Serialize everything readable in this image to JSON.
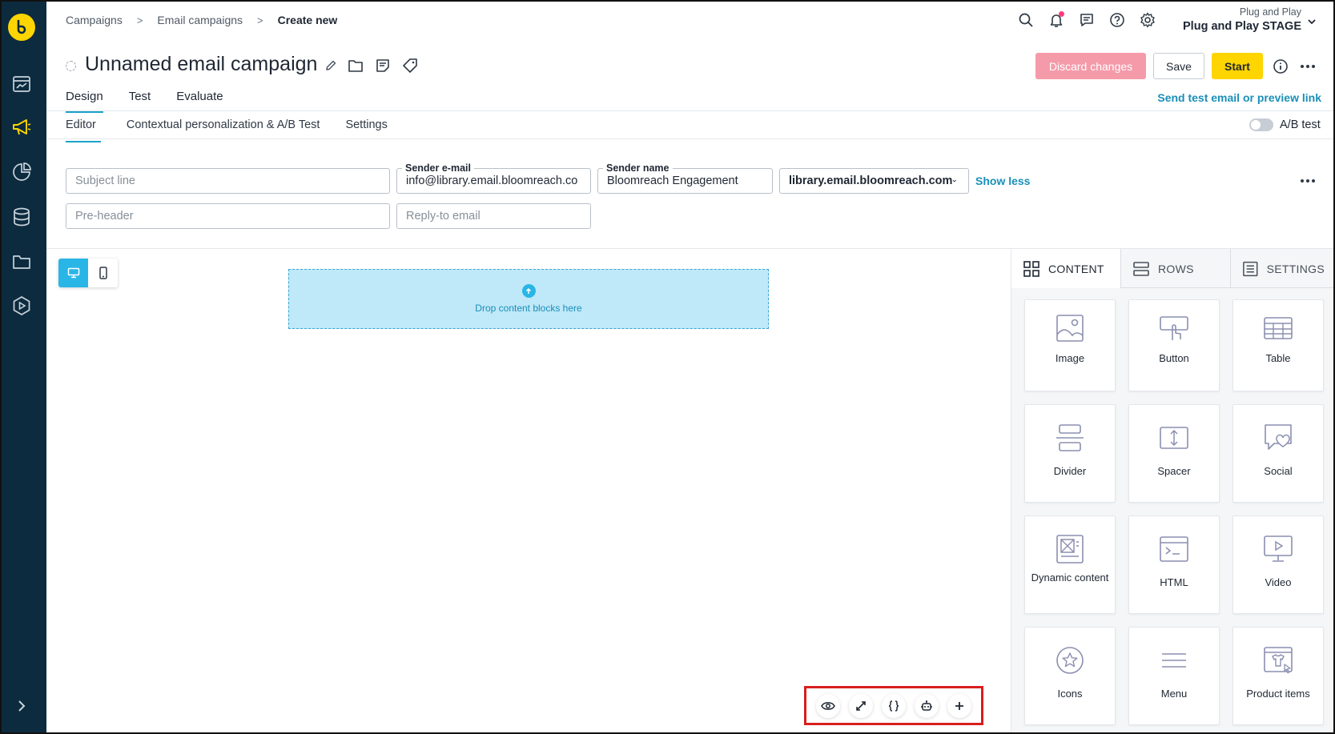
{
  "breadcrumb": {
    "items": [
      "Campaigns",
      "Email campaigns"
    ],
    "current": "Create new",
    "separator": ">"
  },
  "project": {
    "org": "Plug and Play",
    "name": "Plug and Play STAGE"
  },
  "campaign": {
    "title": "Unnamed email campaign"
  },
  "actions": {
    "discard": "Discard changes",
    "save": "Save",
    "start": "Start"
  },
  "tabs": {
    "main": [
      "Design",
      "Test",
      "Evaluate"
    ],
    "active": "Design",
    "send_test_link": "Send test email or preview link"
  },
  "subtabs": {
    "items": [
      "Editor",
      "Contextual personalization & A/B Test",
      "Settings"
    ],
    "active": "Editor",
    "ab_test_label": "A/B test",
    "ab_test_enabled": false
  },
  "form": {
    "subject_placeholder": "Subject line",
    "preheader_placeholder": "Pre-header",
    "sender_email_label": "Sender e-mail",
    "sender_email_value": "info@library.email.bloomreach.co",
    "reply_to_placeholder": "Reply-to email",
    "sender_name_label": "Sender name",
    "sender_name_value": "Bloomreach Engagement",
    "domain_value": "library.email.bloomreach.com",
    "show_less": "Show less"
  },
  "canvas": {
    "drop_text": "Drop content blocks here",
    "device_active": "desktop"
  },
  "panel": {
    "tabs": [
      "CONTENT",
      "ROWS",
      "SETTINGS"
    ],
    "active_tab": "CONTENT",
    "blocks": [
      "Image",
      "Button",
      "Table",
      "Divider",
      "Spacer",
      "Social",
      "Dynamic content",
      "HTML",
      "Video",
      "Icons",
      "Menu",
      "Product items"
    ]
  },
  "toolbar": {
    "buttons": [
      "preview-icon",
      "fullscreen-icon",
      "code-braces-icon",
      "bot-icon",
      "plus-icon"
    ]
  },
  "colors": {
    "rail": "#0d2b3e",
    "accent": "#ffd500",
    "link": "#1a8fb8",
    "discard": "#f59aa9",
    "dropzone": "#bfe8f8",
    "highlight": "#d81e1e"
  }
}
